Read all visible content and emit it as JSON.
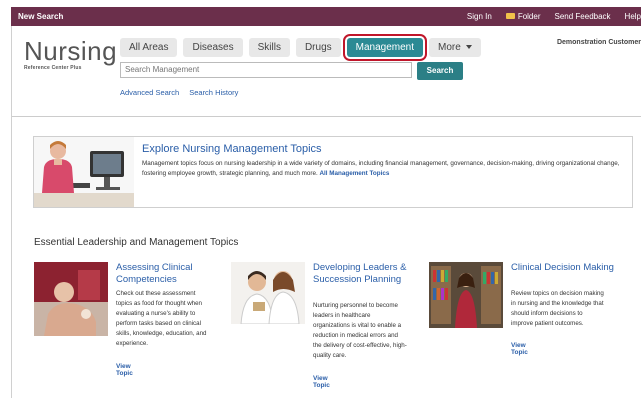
{
  "topbar": {
    "new_search": "New Search",
    "sign_in": "Sign In",
    "folder": "Folder",
    "send_feedback": "Send Feedback",
    "help": "Help"
  },
  "logo": {
    "title": "Nursing",
    "subtitle": "Reference Center Plus"
  },
  "tabs": [
    "All Areas",
    "Diseases",
    "Skills",
    "Drugs",
    "Management",
    "More"
  ],
  "active_tab": "Management",
  "customer": "Demonstration Customer",
  "search": {
    "placeholder": "Search Management",
    "button": "Search"
  },
  "sublinks": {
    "advanced": "Advanced Search",
    "history": "Search History"
  },
  "banner": {
    "title": "Explore Nursing Management Topics",
    "text": "Management topics focus on nursing leadership in a wide variety of domains, including financial management, governance, decision-making, driving organizational change, fostering employee growth, strategic planning, and much more.",
    "link": "All Management Topics"
  },
  "section_title": "Essential Leadership and Management Topics",
  "cards": [
    {
      "title": "Assessing Clinical Competencies",
      "desc": "Check out these assessment topics as food for thought when evaluating a nurse's ability to perform tasks based on clinical skills, knowledge, education, and experience.",
      "link": "View Topic"
    },
    {
      "title": "Developing Leaders & Succession Planning",
      "desc": "Nurturing personnel to become leaders in healthcare organizations is vital to enable a reduction in medical errors and the delivery of cost-effective, high-quality care.",
      "link": "View Topic"
    },
    {
      "title": "Clinical Decision Making",
      "desc": "Review topics on decision making in nursing and the knowledge that should inform decisions to improve patient outcomes.",
      "link": "View Topic"
    }
  ],
  "colors": {
    "topbar": "#6b2f4b",
    "accent": "#2b8a94",
    "link": "#2a5ea8",
    "highlight": "#c0162a"
  }
}
